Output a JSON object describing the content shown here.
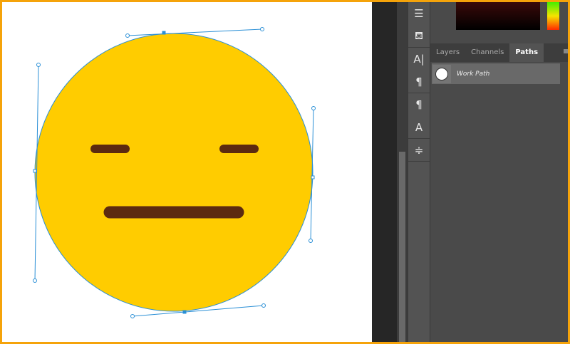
{
  "panel": {
    "tabs": [
      {
        "label": "Layers"
      },
      {
        "label": "Channels"
      },
      {
        "label": "Paths"
      }
    ],
    "active_tab": "Paths",
    "paths": [
      {
        "name": "Work Path"
      }
    ]
  },
  "colors": {
    "face": "#ffcc00",
    "features": "#5c2a10",
    "path": "#2a8fd6"
  },
  "tools": [
    "path-select",
    "clone-source",
    "character",
    "paragraph",
    "paragraph-styles",
    "character-styles",
    "adjustments"
  ]
}
